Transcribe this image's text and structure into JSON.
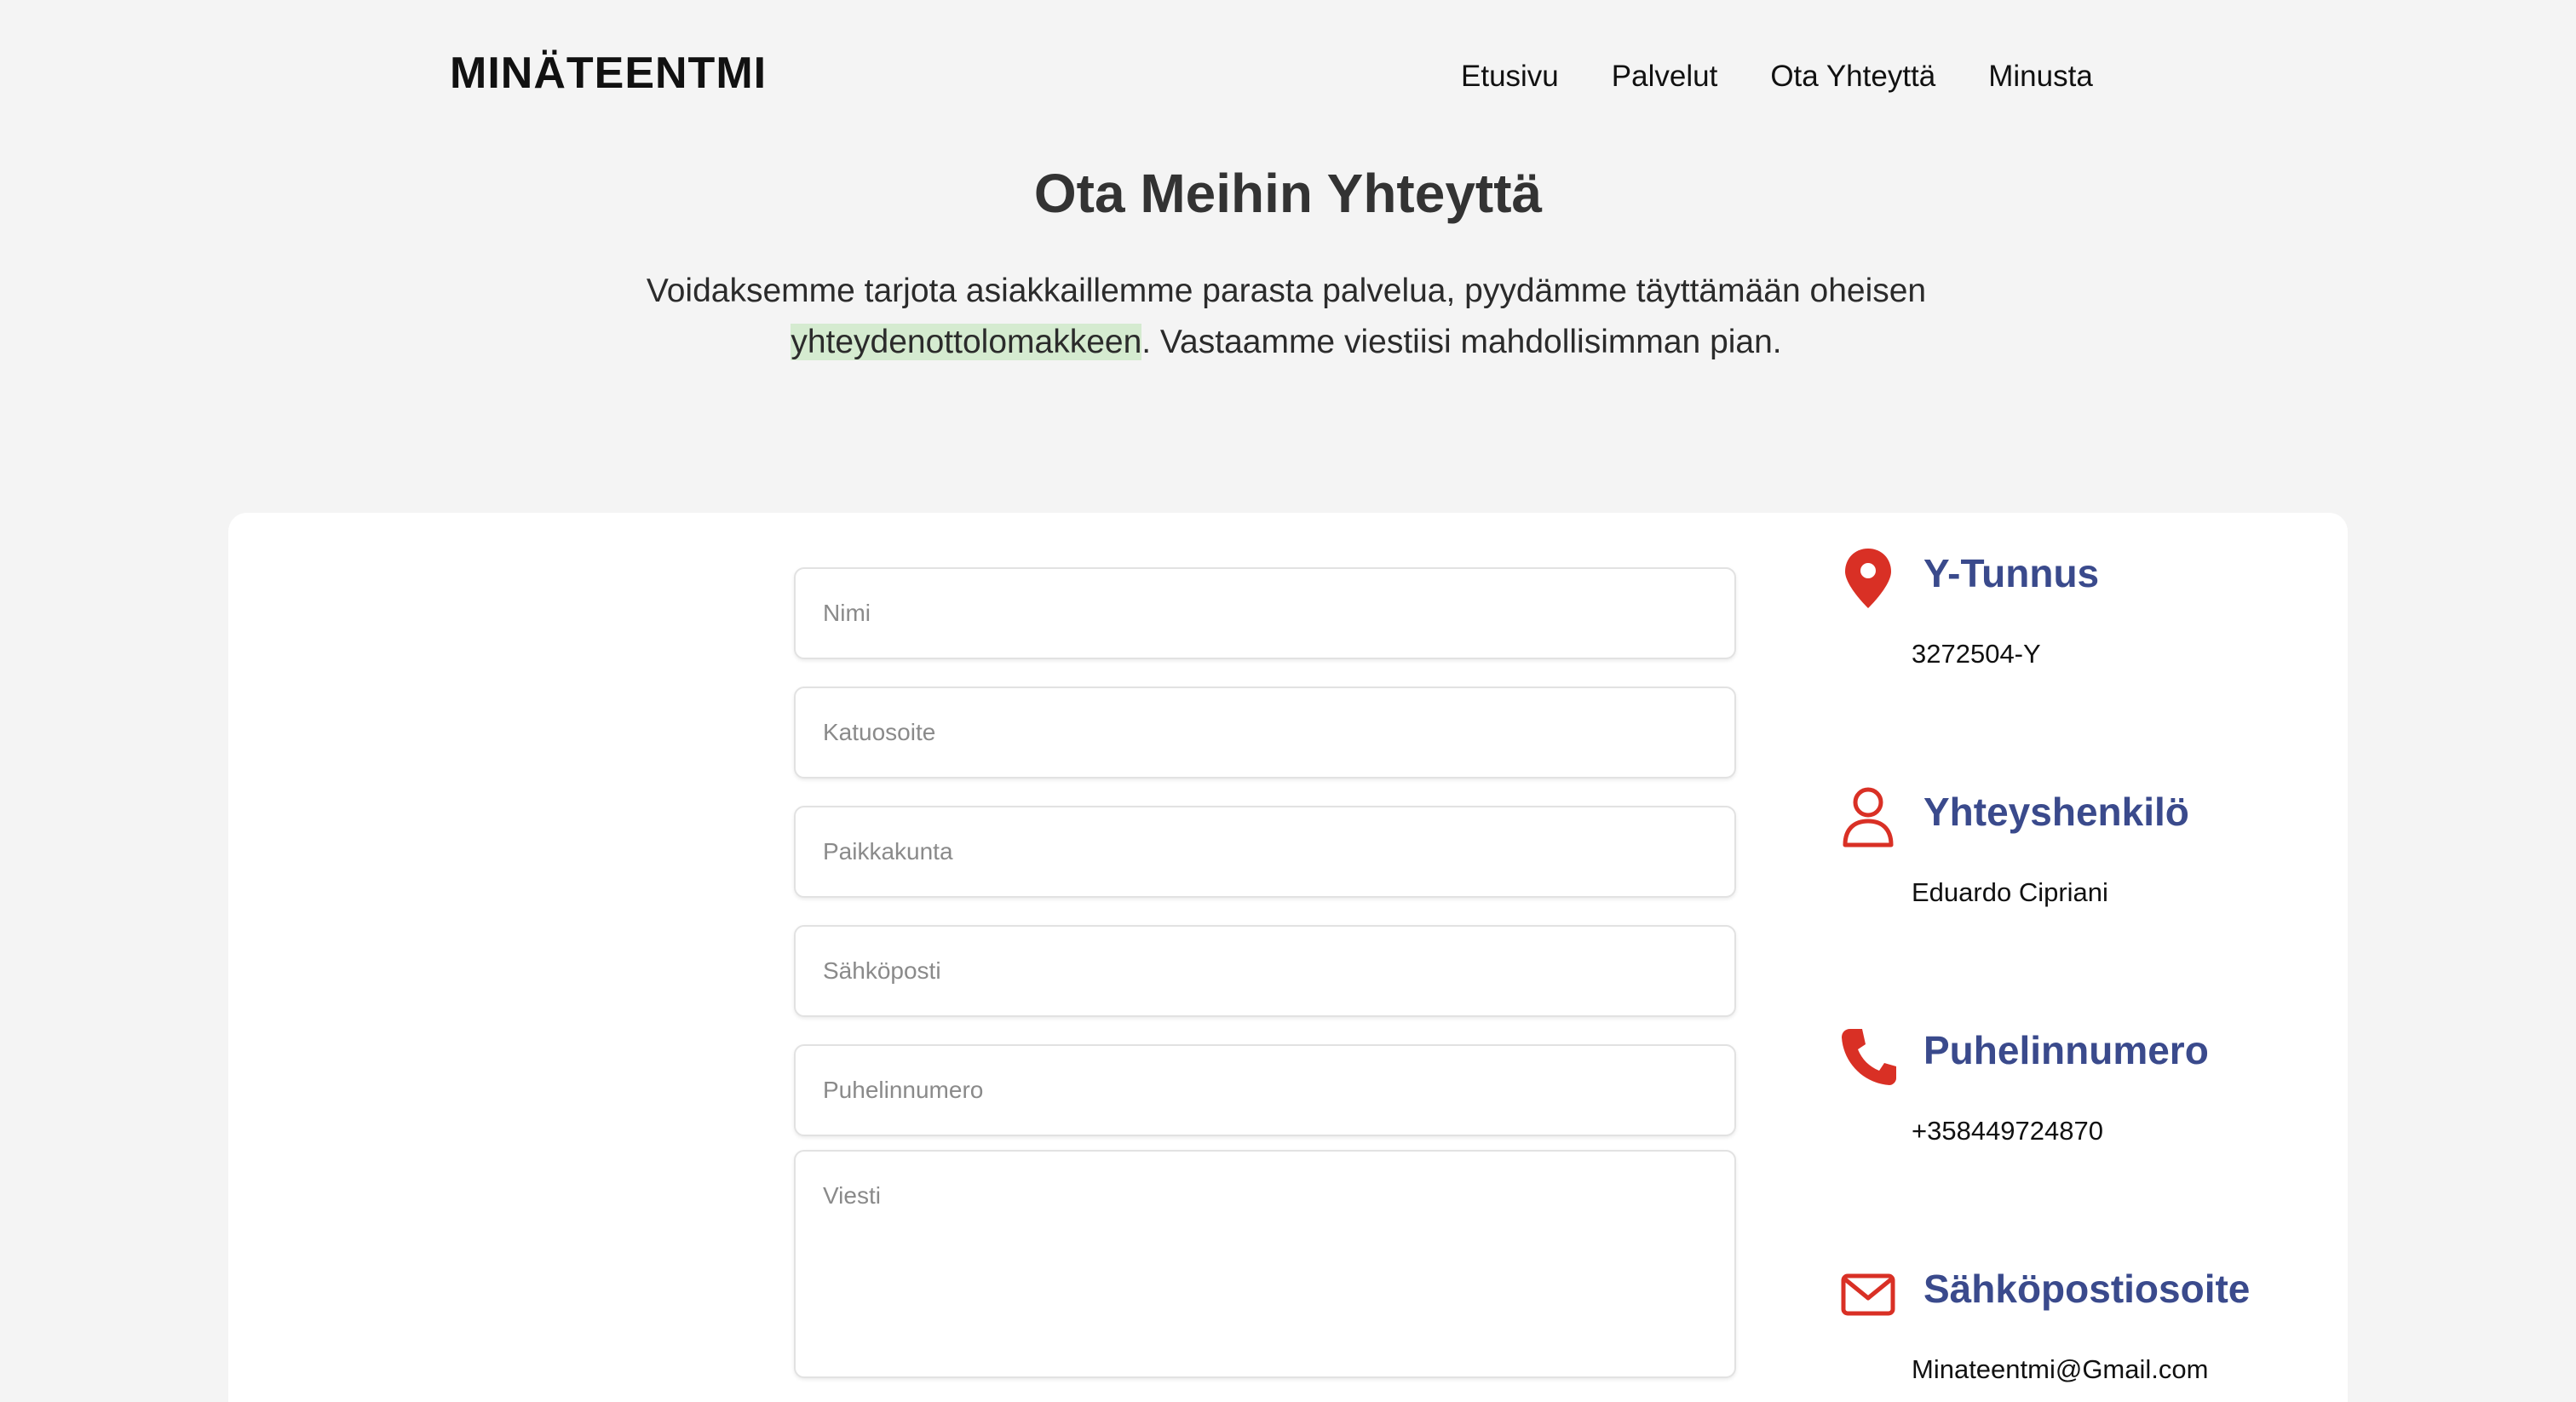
{
  "header": {
    "logo": "MINÄTEENTMI",
    "nav": [
      "Etusivu",
      "Palvelut",
      "Ota Yhteyttä",
      "Minusta"
    ]
  },
  "hero": {
    "title": "Ota Meihin Yhteyttä",
    "intro_before": "Voidaksemme tarjota asiakkaillemme parasta palvelua, pyydämme täyttämään oheisen ",
    "intro_highlight": "yhteydenottolomakkeen",
    "intro_after": ". Vastaamme viestiisi mahdollisimman pian."
  },
  "form": {
    "name_placeholder": "Nimi",
    "street_placeholder": "Katuosoite",
    "city_placeholder": "Paikkakunta",
    "email_placeholder": "Sähköposti",
    "phone_placeholder": "Puhelinnumero",
    "message_placeholder": "Viesti"
  },
  "info": [
    {
      "icon": "location-pin-icon",
      "heading": "Y-Tunnus",
      "value": "3272504-Y"
    },
    {
      "icon": "user-icon",
      "heading": "Yhteyshenkilö",
      "value": "Eduardo Cipriani"
    },
    {
      "icon": "phone-icon",
      "heading": "Puhelinnumero",
      "value": "+358449724870"
    },
    {
      "icon": "envelope-icon",
      "heading": "Sähköpostiosoite",
      "value": "Minateentmi@Gmail.com"
    }
  ],
  "colors": {
    "background": "#f4f4f4",
    "card": "#ffffff",
    "icon_red": "#d93025",
    "heading_blue": "#3a4a8c",
    "highlight": "#d5ebd0"
  }
}
